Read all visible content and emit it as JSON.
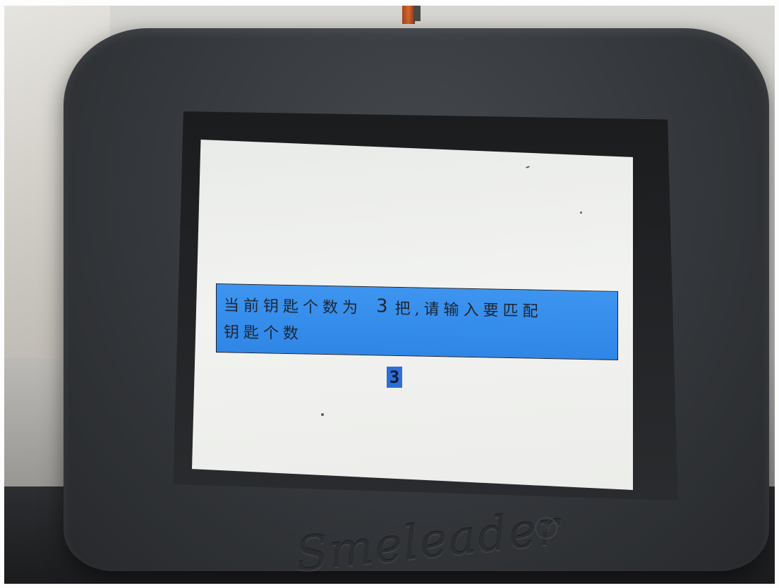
{
  "screen": {
    "message": {
      "line1_prefix": "当前钥匙个数为",
      "current_key_count": "3",
      "line1_suffix": "把,请输入要匹配",
      "line2": "钥匙个数"
    },
    "input": {
      "value": "3"
    }
  },
  "device": {
    "logo_text": "Smeleader",
    "registered_mark": "®"
  },
  "colors": {
    "banner": "#3d95f0",
    "screen_bg": "#eeefec",
    "input_highlight": "#2c6fd6",
    "device_body": "#3a3d41"
  }
}
